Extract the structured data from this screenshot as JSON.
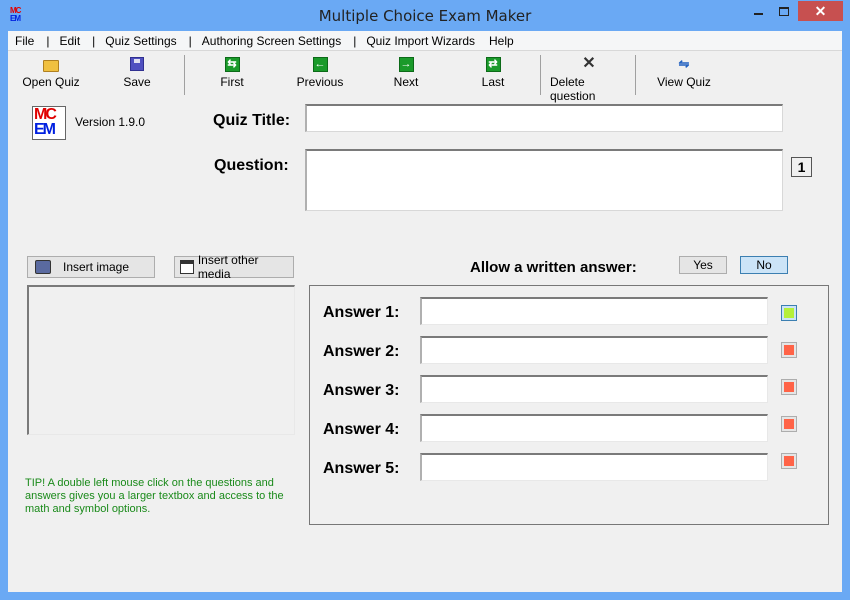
{
  "window": {
    "title": "Multiple Choice Exam Maker",
    "app_icon_top": "MC",
    "app_icon_bottom": "EM",
    "minimize_icon": "minimize-icon",
    "maximize_icon": "maximize-icon",
    "close_icon": "close-icon",
    "close_glyph": "✕"
  },
  "menu": {
    "items": [
      "File",
      "Edit",
      "Quiz Settings",
      "Authoring Screen Settings",
      "Quiz Import Wizards",
      "Help"
    ],
    "separator": "|"
  },
  "toolbar": {
    "open_quiz": "Open Quiz",
    "save": "Save",
    "first": "First",
    "previous": "Previous",
    "next": "Next",
    "last": "Last",
    "delete_question": "Delete question",
    "view_quiz": "View Quiz"
  },
  "header": {
    "logo_top": "MC",
    "logo_bottom": "EM",
    "version": "Version 1.9.0"
  },
  "form": {
    "quiz_title_label": "Quiz Title:",
    "quiz_title_value": "",
    "question_label": "Question:",
    "question_value": "",
    "question_number": "1"
  },
  "media": {
    "insert_image": "Insert image",
    "insert_other_media": "Insert other media"
  },
  "written_answer": {
    "label": "Allow a written answer:",
    "yes": "Yes",
    "no": "No",
    "selected": "No"
  },
  "answers": [
    {
      "label": "Answer 1:",
      "value": "",
      "correct": true,
      "color": "#b5f03a"
    },
    {
      "label": "Answer 2:",
      "value": "",
      "correct": false,
      "color": "#ff6347"
    },
    {
      "label": "Answer 3:",
      "value": "",
      "correct": false,
      "color": "#ff6347"
    },
    {
      "label": "Answer 4:",
      "value": "",
      "correct": false,
      "color": "#ff6347"
    },
    {
      "label": "Answer 5:",
      "value": "",
      "correct": false,
      "color": "#ff6347"
    }
  ],
  "tip": "TIP! A double left mouse click on the questions and answers gives you a larger textbox and access to the math and symbol options.",
  "colors": {
    "titlebar": "#6aa9f4",
    "close_button": "#c75050",
    "tip_text": "#1a8a1a",
    "correct_mark": "#b5f03a",
    "incorrect_mark": "#ff6347",
    "nav_icon": "#1a9a2a"
  }
}
